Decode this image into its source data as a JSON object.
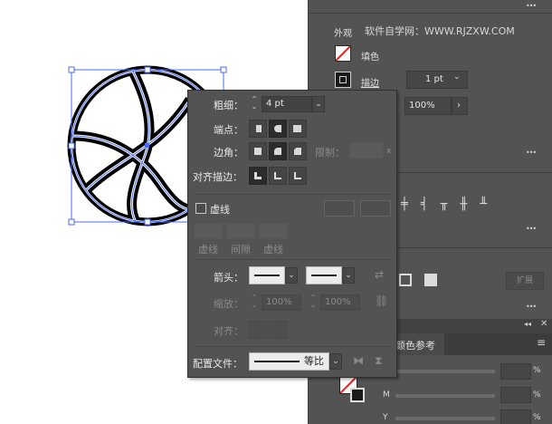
{
  "right_panel": {
    "appearance_label": "外观",
    "watermark": "软件自学网：WWW.RJZXW.COM",
    "fill_label": "填色",
    "stroke_label": "描边",
    "stroke_weight": "1 pt",
    "opacity_value": "100%",
    "bottom_tab_label": "颜色参考",
    "color_rows": [
      {
        "letter": "",
        "unit": "%"
      },
      {
        "letter": "M",
        "unit": "%"
      },
      {
        "letter": "Y",
        "unit": "%"
      }
    ]
  },
  "stroke_popup": {
    "weight_label": "粗细：",
    "weight_value": "4 pt",
    "cap_label": "端点：",
    "corner_label": "边角：",
    "limit_label": "限制：",
    "limit_unit": "x",
    "align_label": "对齐描边：",
    "dashed_label": "虚线",
    "dash_labels": [
      "虚线",
      "间隙",
      "虚线"
    ],
    "arrow_label": "箭头：",
    "scale_label": "缩放：",
    "scale_values": [
      "100%",
      "100%"
    ],
    "arrow_align_label": "对齐：",
    "profile_label": "配置文件：",
    "profile_value": "等比"
  },
  "colors": {
    "panel_bg": "#535353",
    "selection_blue": "#4a6cf7",
    "artwork_stroke": "#000000"
  }
}
